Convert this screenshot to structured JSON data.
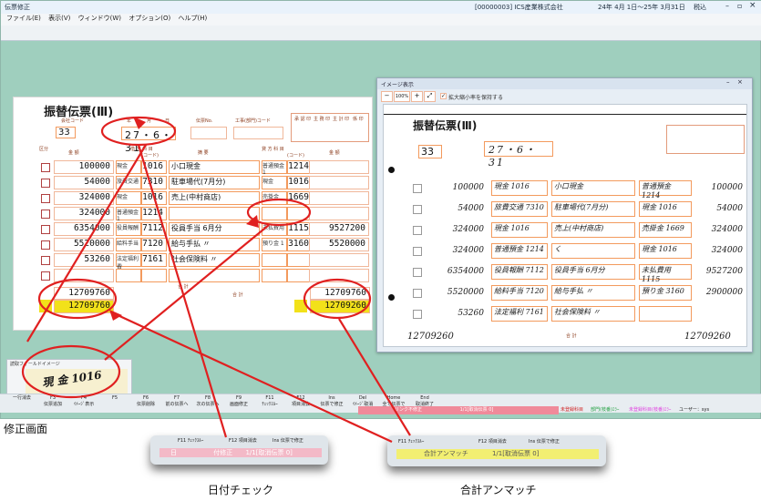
{
  "window": {
    "title": "伝票修正",
    "company": "[00000003] ICS産業株式会社",
    "period": "24年 4月 1日～25年 3月31日",
    "mode": "税込"
  },
  "menu": [
    "ファイル(E)",
    "表示(V)",
    "ウィンドウ(W)",
    "オプション(O)",
    "ヘルプ(H)"
  ],
  "form": {
    "title": "振替伝票(Ⅲ)",
    "labels": {
      "company_code": "会社コード",
      "year": "年",
      "month": "月",
      "day": "日",
      "slip_no": "伝票No.",
      "dept": "工事(部門)コード",
      "section": "区分",
      "amount": "金 額",
      "debit": "借 方 科 目",
      "code": "(コード)",
      "summary": "摘 要",
      "credit": "貸 方 科 目",
      "total": "合 計",
      "box1": "承 認 印",
      "box2": "主 務 印",
      "box3": "主 計 印",
      "box4": "係 印"
    },
    "company_code_value": "33",
    "date_value": "27・6・31",
    "rows": [
      {
        "amt": "100000",
        "dr_name": "現金",
        "dr_code": "1016",
        "memo": "小口現金",
        "cr_name": "普通預金 1",
        "cr_code": "1214",
        "cr_amt": ""
      },
      {
        "amt": "54000",
        "dr_name": "旅費交通",
        "dr_code": "7310",
        "memo": "駐車場代(7月分)",
        "cr_name": "現金",
        "cr_code": "1016",
        "cr_amt": ""
      },
      {
        "amt": "324000",
        "dr_name": "現金",
        "dr_code": "1016",
        "memo": "売上(中村商店)",
        "cr_name": "売掛金",
        "cr_code": "1669",
        "cr_amt": ""
      },
      {
        "amt": "324000",
        "dr_name": "普通預金 1",
        "dr_code": "1214",
        "memo": "",
        "cr_name": "",
        "cr_code": "",
        "cr_amt": ""
      },
      {
        "amt": "6354000",
        "dr_name": "役員報酬",
        "dr_code": "7112",
        "memo": "役員手当 6月分",
        "cr_name": "未払費用",
        "cr_code": "1115",
        "cr_amt": "9527200"
      },
      {
        "amt": "5520000",
        "dr_name": "給料手当",
        "dr_code": "7120",
        "memo": "給与手払 〃",
        "cr_name": "預り金 1",
        "cr_code": "3160",
        "cr_amt": "5520000"
      },
      {
        "amt": "53260",
        "dr_name": "法定福利費",
        "dr_code": "7161",
        "memo": "社会保険料 〃",
        "cr_name": "",
        "cr_code": "",
        "cr_amt": ""
      },
      {
        "amt": "",
        "dr_name": "",
        "dr_code": "",
        "memo": "",
        "cr_name": "",
        "cr_code": "",
        "cr_amt": ""
      }
    ],
    "total_debit_1": "12709760",
    "total_debit_2": "12709760",
    "total_credit_1": "12709760",
    "total_credit_2": "12709260"
  },
  "image_window": {
    "title": "イメージ表示",
    "checkbox": "拡大縮小率を保持する",
    "toolbar": [
      "−",
      "100%",
      "+",
      "⤢"
    ],
    "form_title": "振替伝票(Ⅲ)",
    "company_code": "33",
    "date": "27・6・31",
    "rows": [
      {
        "amt": "100000",
        "dr": "現金 1016",
        "memo": "小口現金",
        "cr": "普通預金 1214",
        "cr_amt": "100000"
      },
      {
        "amt": "54000",
        "dr": "旅費交通 7310",
        "memo": "駐車場代(7月分)",
        "cr": "現金 1016",
        "cr_amt": "54000"
      },
      {
        "amt": "324000",
        "dr": "現金 1016",
        "memo": "売上(中村商店)",
        "cr": "売掛金 1669",
        "cr_amt": "324000"
      },
      {
        "amt": "324000",
        "dr": "普通預金 1214",
        "memo": "く",
        "cr": "現金 1016",
        "cr_amt": "324000"
      },
      {
        "amt": "6354000",
        "dr": "役員報酬 7112",
        "memo": "役員手当 6月分",
        "cr": "未払費用 1115",
        "cr_amt": "9527200"
      },
      {
        "amt": "5520000",
        "dr": "給料手当 7120",
        "memo": "給与手払 〃",
        "cr": "預り金 3160",
        "cr_amt": "2900000"
      },
      {
        "amt": "53260",
        "dr": "法定福利 7161",
        "memo": "社会保険料 〃",
        "cr": "",
        "cr_amt": ""
      }
    ],
    "total_left": "12709260",
    "total_label": "合 計",
    "total_right": "12709260"
  },
  "recognition_panel": {
    "title": "読取フィールドイメージ",
    "sample": "現 金 1016"
  },
  "fkeys": [
    {
      "key": "",
      "label": "一行消去"
    },
    {
      "key": "F3",
      "label": "伝票追加"
    },
    {
      "key": "F4",
      "label": "ｲﾒｰｼﾞ表示"
    },
    {
      "key": "F5",
      "label": ""
    },
    {
      "key": "F6",
      "label": "伝票削除"
    },
    {
      "key": "F7",
      "label": "前の伝票へ"
    },
    {
      "key": "F8",
      "label": "次の伝票へ"
    },
    {
      "key": "F9",
      "label": "画面修正"
    },
    {
      "key": "F11",
      "label": "ﾁｪｯｸｽﾙｰ"
    },
    {
      "key": "F12",
      "label": "項目消去"
    },
    {
      "key": "Ins",
      "label": "伝票で修正"
    },
    {
      "key": "Del",
      "label": "ｲﾒｰｼﾞ取消"
    },
    {
      "key": "Home",
      "label": "全て伝票で"
    },
    {
      "key": "End",
      "label": "取消終了"
    }
  ],
  "status": {
    "error": "リンク不修正",
    "page": "1/1[取消伝票 0]",
    "legend1": "未登録科目",
    "legend2": "部門(枝番)ｴﾗｰ",
    "legend3": "未登録科目(枝番)ｴﾗｰ",
    "user": "ユーザー：sys"
  },
  "caption_screen": "修正画面",
  "zoom_left": {
    "keys": [
      "F11 ﾁｪｯｸｽﾙｰ",
      "F12 項目消去",
      "Ins 伝票で修正"
    ],
    "left_text": "日",
    "bar_text": "付修正",
    "page": "1/1[取消伝票 0]"
  },
  "zoom_right": {
    "keys": [
      "F11 ﾁｪｯｸｽﾙｰ",
      "F12 項目消去",
      "Ins 伝票で修正"
    ],
    "bar_text": "合計アンマッチ",
    "page": "1/1[取消伝票 0]"
  },
  "caption_date": "日付チェック",
  "caption_total": "合計アンマッチ",
  "colors": {
    "annotation": "#e02020",
    "bg": "#9fcfbe",
    "form_line": "#f39a5d",
    "total_fill": "#f2e11a",
    "zoom_pink": "#f3b9c7",
    "zoom_yellow": "#f2ef72"
  }
}
